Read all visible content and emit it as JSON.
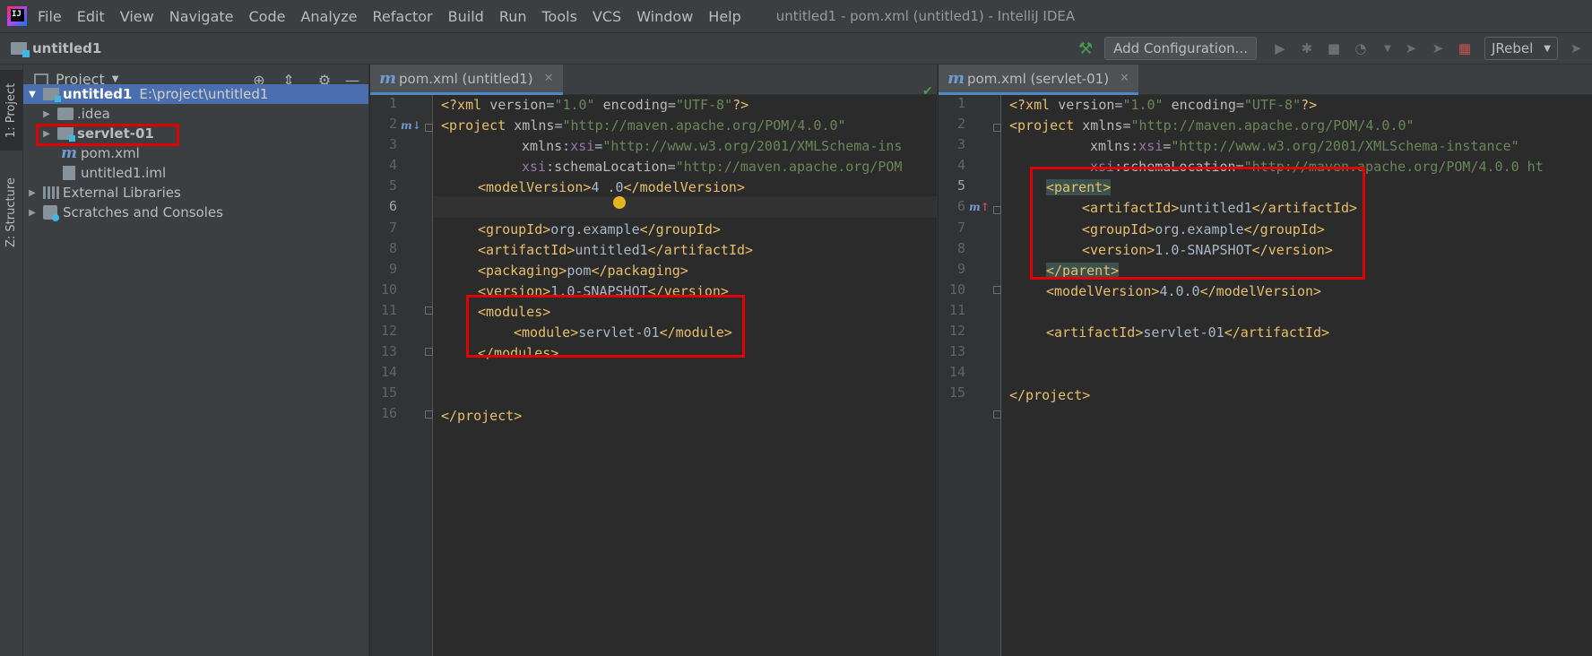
{
  "menubar": {
    "items": [
      "File",
      "Edit",
      "View",
      "Navigate",
      "Code",
      "Analyze",
      "Refactor",
      "Build",
      "Run",
      "Tools",
      "VCS",
      "Window",
      "Help"
    ],
    "title": "untitled1 - pom.xml (untitled1) - IntelliJ IDEA"
  },
  "navbar": {
    "project_name": "untitled1",
    "add_configuration_label": "Add Configuration...",
    "jrebel_label": "JRebel"
  },
  "tool_stripe": {
    "project_label": "1: Project",
    "structure_label": "Z: Structure"
  },
  "project_panel": {
    "title": "Project",
    "tree": [
      {
        "label": "untitled1",
        "path": "E:\\project\\untitled1"
      },
      {
        "label": ".idea"
      },
      {
        "label": "servlet-01"
      },
      {
        "label": "pom.xml"
      },
      {
        "label": "untitled1.iml"
      },
      {
        "label": "External Libraries"
      },
      {
        "label": "Scratches and Consoles"
      }
    ]
  },
  "editors": {
    "left": {
      "tab_label": "pom.xml (untitled1)",
      "lines": [
        "1",
        "2",
        "3",
        "4",
        "5",
        "6",
        "7",
        "8",
        "9",
        "10",
        "11",
        "12",
        "13",
        "14",
        "15",
        "16"
      ]
    },
    "right": {
      "tab_label": "pom.xml (servlet-01)",
      "lines": [
        "1",
        "2",
        "3",
        "4",
        "5",
        "6",
        "7",
        "8",
        "9",
        "10",
        "11",
        "12",
        "13",
        "14",
        "15"
      ]
    }
  },
  "code": {
    "xml_decl_open": "<?xml",
    "version_attr": "version",
    "version_val": "\"1.0\"",
    "encoding_attr": "encoding",
    "encoding_val": "\"UTF-8\"",
    "xml_decl_close": "?>",
    "project_open": "<project",
    "xmlns_attr": "xmlns",
    "xmlns_val": "\"http://maven.apache.org/POM/4.0.0\"",
    "xmlns_prefix": "xmlns",
    "xsi_ns": "xsi",
    "xsi_val_left": "\"http://www.w3.org/2001/XMLSchema-ins",
    "xsi_val_right": "\"http://www.w3.org/2001/XMLSchema-instance\"",
    "schema_attr": "schemaLocation",
    "schema_val_left": "\"http://maven.apache.org/POM",
    "schema_val_right": "\"http://maven.apache.org/POM/4.0.0 ht",
    "tag_close": ">",
    "model_version_left_a": "4",
    "model_version_left_b": ".0",
    "model_version_right": "4.0.0",
    "group_id": "org.example",
    "artifact_id_left": "untitled1",
    "packaging": "pom",
    "version": "1.0-SNAPSHOT",
    "module": "servlet-01",
    "parent_artifact": "untitled1",
    "artifact_id_right": "servlet-01",
    "t_model_open": "<modelVersion>",
    "t_model_close": "</modelVersion>",
    "t_group_open": "<groupId>",
    "t_group_close": "</groupId>",
    "t_artifact_open": "<artifactId>",
    "t_artifact_close": "</artifactId>",
    "t_packaging_open": "<packaging>",
    "t_packaging_close": "</packaging>",
    "t_version_open": "<version>",
    "t_version_close": "</version>",
    "t_modules_open": "<modules>",
    "t_modules_close": "</modules>",
    "t_module_open": "<module>",
    "t_module_close": "</module>",
    "t_parent_open": "<parent>",
    "t_parent_close": "</parent>",
    "t_project_close": "</project>"
  },
  "colors": {
    "accent": "#4b6eaf",
    "highlight_box": "#e00000",
    "xml_tag": "#e8bf6a",
    "xml_value": "#6a8759",
    "xml_namespace": "#9876aa"
  }
}
